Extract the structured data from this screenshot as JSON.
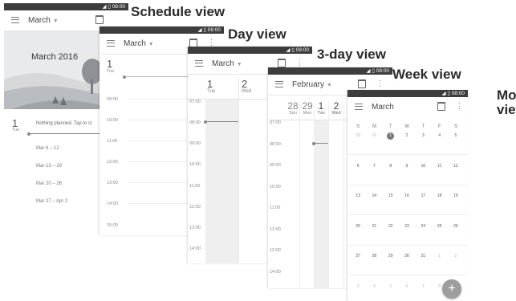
{
  "status_time": "08:00",
  "labels": {
    "schedule": "Schedule view",
    "day": "Day view",
    "three_day": "3-day view",
    "week": "Week view",
    "month_line1": "Month",
    "month_line2": "view"
  },
  "schedule_view": {
    "title": "March",
    "banner": "March 2016",
    "day_num": "1",
    "day_name": "Tue",
    "empty_text": "Nothing planned. Tap to cr",
    "weeks": [
      "Mar 6 – 12",
      "Mar 13 – 19",
      "Mar 20 – 26",
      "Mar 27 – Apr 2"
    ]
  },
  "day_view": {
    "title": "March",
    "day_num": "1",
    "day_name": "Tue",
    "times": [
      "09:00",
      "10:00",
      "11:00",
      "12:00",
      "13:00",
      "14:00",
      "15:00"
    ]
  },
  "three_day_view": {
    "title": "March",
    "days": [
      {
        "num": "1",
        "name": "Tue"
      },
      {
        "num": "2",
        "name": "Wed"
      }
    ],
    "times": [
      "07:00",
      "08:00",
      "09:00",
      "10:00",
      "11:00",
      "12:00",
      "13:00",
      "14:00"
    ]
  },
  "week_view": {
    "title": "February",
    "days": [
      {
        "num": "28",
        "name": "Sun"
      },
      {
        "num": "29",
        "name": "Mon"
      },
      {
        "num": "1",
        "name": "Tue"
      },
      {
        "num": "2",
        "name": "Wed"
      }
    ],
    "times": [
      "07:00",
      "08:00",
      "09:00",
      "10:00",
      "11:00",
      "12:00",
      "13:00",
      "14:00"
    ]
  },
  "month_view": {
    "title": "March",
    "weekdays": [
      "S",
      "M",
      "T",
      "W",
      "T",
      "F",
      "S"
    ],
    "today": "1",
    "weeks": [
      [
        "28",
        "29",
        "1",
        "2",
        "3",
        "4",
        "5"
      ],
      [
        "6",
        "7",
        "8",
        "9",
        "10",
        "11",
        "12"
      ],
      [
        "13",
        "14",
        "15",
        "16",
        "17",
        "18",
        "19"
      ],
      [
        "20",
        "21",
        "22",
        "23",
        "24",
        "25",
        "26"
      ],
      [
        "27",
        "28",
        "29",
        "30",
        "31",
        "1",
        "2"
      ],
      [
        "3",
        "4",
        "5",
        "6",
        "7",
        "8",
        "9"
      ]
    ],
    "fab": "+"
  }
}
